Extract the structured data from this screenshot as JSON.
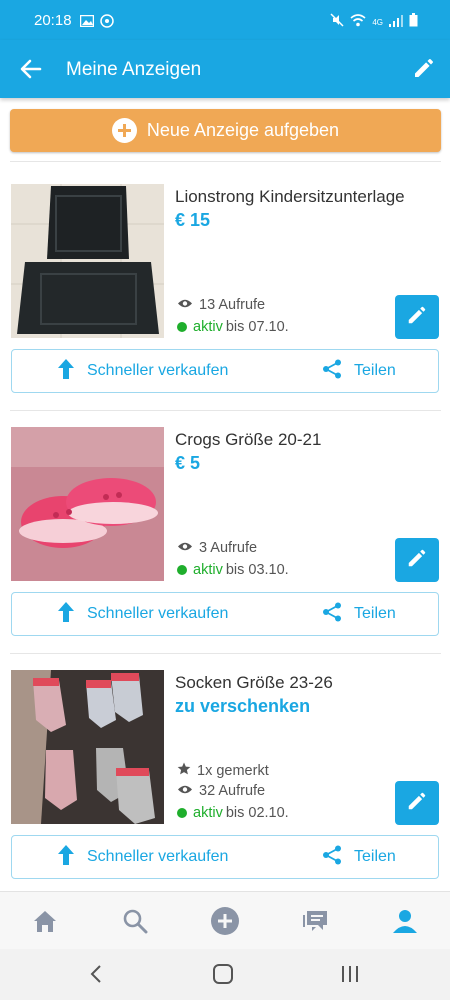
{
  "status_bar": {
    "time": "20:18",
    "network": "4G"
  },
  "app_bar": {
    "title": "Meine Anzeigen"
  },
  "new_ad_button": {
    "label": "Neue Anzeige aufgeben"
  },
  "listings": [
    {
      "title": "Lionstrong Kindersitzunterlage",
      "price": "€ 15",
      "views": "13 Aufrufe",
      "status_active": "aktiv",
      "status_until": "bis 07.10.",
      "sell_label": "Schneller verkaufen",
      "share_label": "Teilen"
    },
    {
      "title": "Crogs Größe 20-21",
      "price": "€ 5",
      "views": "3 Aufrufe",
      "status_active": "aktiv",
      "status_until": "bis 03.10.",
      "sell_label": "Schneller verkaufen",
      "share_label": "Teilen"
    },
    {
      "title": "Socken Größe 23-26",
      "price": "zu verschenken",
      "watched": "1x gemerkt",
      "views": "32 Aufrufe",
      "status_active": "aktiv",
      "status_until": "bis 02.10.",
      "sell_label": "Schneller verkaufen",
      "share_label": "Teilen"
    }
  ],
  "bottom_nav": [
    "home-icon",
    "search-icon",
    "add-icon",
    "messages-icon",
    "profile-icon"
  ],
  "colors": {
    "primary": "#1aa7e2",
    "accent_orange": "#f0a855",
    "active_green": "#1fae2c"
  }
}
